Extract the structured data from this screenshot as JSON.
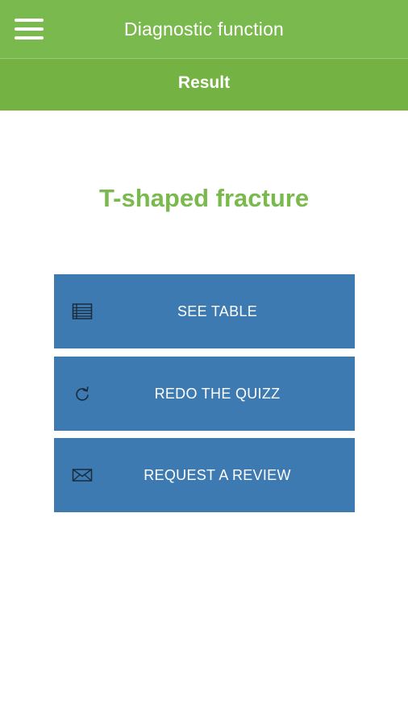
{
  "header": {
    "title": "Diagnostic function",
    "menu_icon": "hamburger-menu-icon",
    "color": "#7ab94e"
  },
  "subheader": {
    "title": "Result",
    "color": "#74b243"
  },
  "result": {
    "title": "T-shaped fracture",
    "color": "#7ab94e"
  },
  "actions": [
    {
      "label": "SEE TABLE",
      "icon": "table-icon"
    },
    {
      "label": "REDO THE QUIZZ",
      "icon": "refresh-icon"
    },
    {
      "label": "REQUEST A REVIEW",
      "icon": "envelope-icon"
    }
  ],
  "button_color": "#3c7ab1"
}
